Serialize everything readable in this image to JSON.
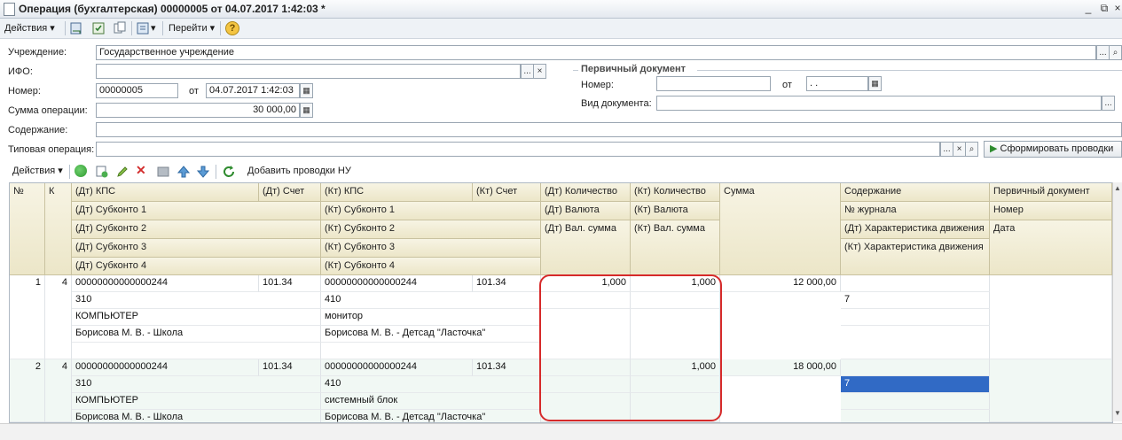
{
  "window": {
    "title": "Операция (бухгалтерская) 00000005 от 04.07.2017 1:42:03 *",
    "minimize": "_",
    "restore": "⧉",
    "close": "×"
  },
  "toolbar": {
    "actions_label": "Действия",
    "goto_label": "Перейти",
    "help_label": "?"
  },
  "form": {
    "institution_label": "Учреждение:",
    "institution_value": "Государственное учреждение",
    "ifo_label": "ИФО:",
    "ifo_value": "",
    "number_label": "Номер:",
    "number_value": "00000005",
    "from_label": "от",
    "date_value": "04.07.2017  1:42:03",
    "amount_label": "Сумма операции:",
    "amount_value": "30 000,00",
    "content_label": "Содержание:",
    "content_value": "",
    "typical_op_label": "Типовая операция:",
    "typical_op_value": "",
    "generate_button": "Сформировать проводки",
    "ellipsis": "...",
    "clear": "×",
    "search": "⌕"
  },
  "primary_doc": {
    "group_title": "Первичный документ",
    "number_label": "Номер:",
    "number_value": "",
    "from_label": "от",
    "date_value": " .  .",
    "doc_type_label": "Вид документа:",
    "doc_type_value": ""
  },
  "table_toolbar": {
    "actions_label": "Действия",
    "add_nu_label": "Добавить проводки НУ"
  },
  "grid": {
    "headers": {
      "num": "№",
      "k": "К",
      "dt_kps": "(Дт) КПС",
      "dt_acc": "(Дт) Счет",
      "kt_kps": "(Кт) КПС",
      "kt_acc": "(Кт) Счет",
      "dt_qty": "(Дт) Количество",
      "kt_qty": "(Кт) Количество",
      "sum": "Сумма",
      "content": "Содержание",
      "primary": "Первичный документ",
      "dt_sub1": "(Дт) Субконто 1",
      "kt_sub1": "(Кт) Субконто 1",
      "dt_cur": "(Дт) Валюта",
      "kt_cur": "(Кт) Валюта",
      "journal": "№ журнала",
      "pnum": "Номер",
      "dt_sub2": "(Дт) Субконто 2",
      "kt_sub2": "(Кт) Субконто 2",
      "dt_cursum": "(Дт) Вал. сумма",
      "kt_cursum": "(Кт) Вал. сумма",
      "dt_char": "(Дт) Характеристика движения",
      "pdate": "Дата",
      "dt_sub3": "(Дт) Субконто 3",
      "kt_sub3": "(Кт) Субконто 3",
      "kt_char": "(Кт) Характеристика движения",
      "dt_sub4": "(Дт) Субконто 4",
      "kt_sub4": "(Кт) Субконто 4"
    },
    "rows": [
      {
        "num": "1",
        "k": "4",
        "dt_kps": "00000000000000244",
        "dt_acc": "101.34",
        "kt_kps": "00000000000000244",
        "kt_acc": "101.34",
        "dt_qty": "1,000",
        "kt_qty": "1,000",
        "sum": "12 000,00",
        "dt_sub1": "310",
        "kt_sub1": "410",
        "journal": "7",
        "dt_sub2": "КОМПЬЮТЕР",
        "kt_sub2": "монитор",
        "dt_sub3": "Борисова М. В. - Школа",
        "kt_sub3": "Борисова М. В. - Детсад \"Ласточка\""
      },
      {
        "num": "2",
        "k": "4",
        "dt_kps": "00000000000000244",
        "dt_acc": "101.34",
        "kt_kps": "00000000000000244",
        "kt_acc": "101.34",
        "dt_qty": "",
        "kt_qty": "1,000",
        "sum": "18 000,00",
        "dt_sub1": "310",
        "kt_sub1": "410",
        "journal": "7",
        "dt_sub2": "КОМПЬЮТЕР",
        "kt_sub2": "системный блок",
        "dt_sub3": "Борисова М. В. - Школа",
        "kt_sub3": "Борисова М. В. - Детсад \"Ласточка\""
      }
    ]
  }
}
